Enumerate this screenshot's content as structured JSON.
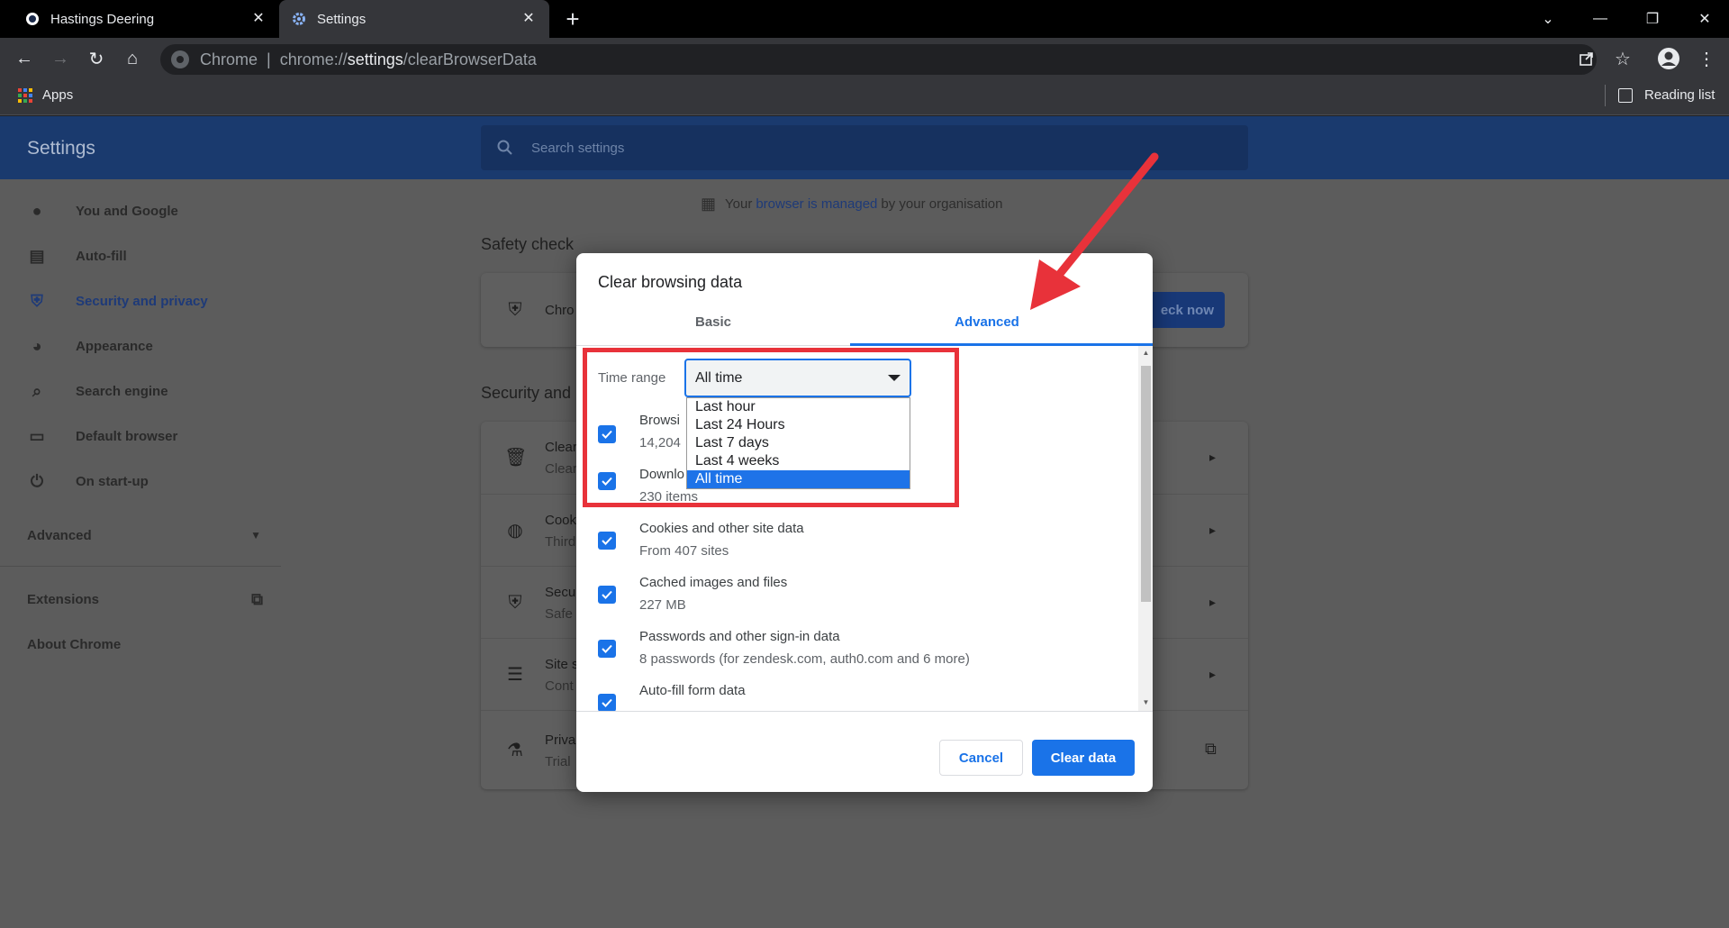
{
  "browser": {
    "tabs": [
      {
        "title": "Hastings Deering",
        "active": false
      },
      {
        "title": "Settings",
        "active": true
      }
    ],
    "omnibox": {
      "origin": "Chrome",
      "separator": "|",
      "scheme": "chrome://",
      "host": "settings",
      "path": "/clearBrowserData"
    },
    "bookmarks": {
      "apps_label": "Apps",
      "reading_list_label": "Reading list"
    }
  },
  "settings": {
    "title": "Settings",
    "search_placeholder": "Search settings",
    "nav": [
      {
        "label": "You and Google",
        "icon": "person-icon"
      },
      {
        "label": "Auto-fill",
        "icon": "clipboard-icon"
      },
      {
        "label": "Security and privacy",
        "icon": "shield-icon",
        "selected": true
      },
      {
        "label": "Appearance",
        "icon": "palette-icon"
      },
      {
        "label": "Search engine",
        "icon": "search-icon"
      },
      {
        "label": "Default browser",
        "icon": "browser-icon"
      },
      {
        "label": "On start-up",
        "icon": "power-icon"
      }
    ],
    "nav_advanced": "Advanced",
    "nav_extensions": "Extensions",
    "nav_about": "About Chrome",
    "managed": {
      "prefix": "Your",
      "link": "browser is managed",
      "suffix": "by your organisation"
    },
    "safety_check": {
      "title": "Safety check",
      "row_text": "Chro",
      "button": "eck now"
    },
    "security_section": {
      "title": "Security and",
      "rows": [
        {
          "title": "Clear",
          "sub": "Clear"
        },
        {
          "title": "Cook",
          "sub": "Third"
        },
        {
          "title": "Secu",
          "sub": "Safe"
        },
        {
          "title": "Site s",
          "sub": "Cont"
        },
        {
          "title": "Priva",
          "sub": "Trial"
        }
      ]
    }
  },
  "dialog": {
    "title": "Clear browsing data",
    "tabs": {
      "basic": "Basic",
      "advanced": "Advanced",
      "active": "Advanced"
    },
    "time_range": {
      "label": "Time range",
      "value": "All time",
      "options": [
        "Last hour",
        "Last 24 Hours",
        "Last 7 days",
        "Last 4 weeks",
        "All time"
      ],
      "selected": "All time"
    },
    "items": [
      {
        "title": "Browsi",
        "sub": "14,204",
        "checked": true
      },
      {
        "title": "Downlo",
        "sub": "230 items",
        "checked": true
      },
      {
        "title": "Cookies and other site data",
        "sub": "From 407 sites",
        "checked": true
      },
      {
        "title": "Cached images and files",
        "sub": "227 MB",
        "checked": true
      },
      {
        "title": "Passwords and other sign-in data",
        "sub": "8 passwords (for zendesk.com, auth0.com and 6 more)",
        "checked": true
      },
      {
        "title": "Auto-fill form data",
        "sub": "",
        "checked": true
      }
    ],
    "buttons": {
      "cancel": "Cancel",
      "confirm": "Clear data"
    }
  },
  "colors": {
    "accent": "#1a73e8",
    "annotation": "#e8323a",
    "header": "#1a3a6e"
  }
}
